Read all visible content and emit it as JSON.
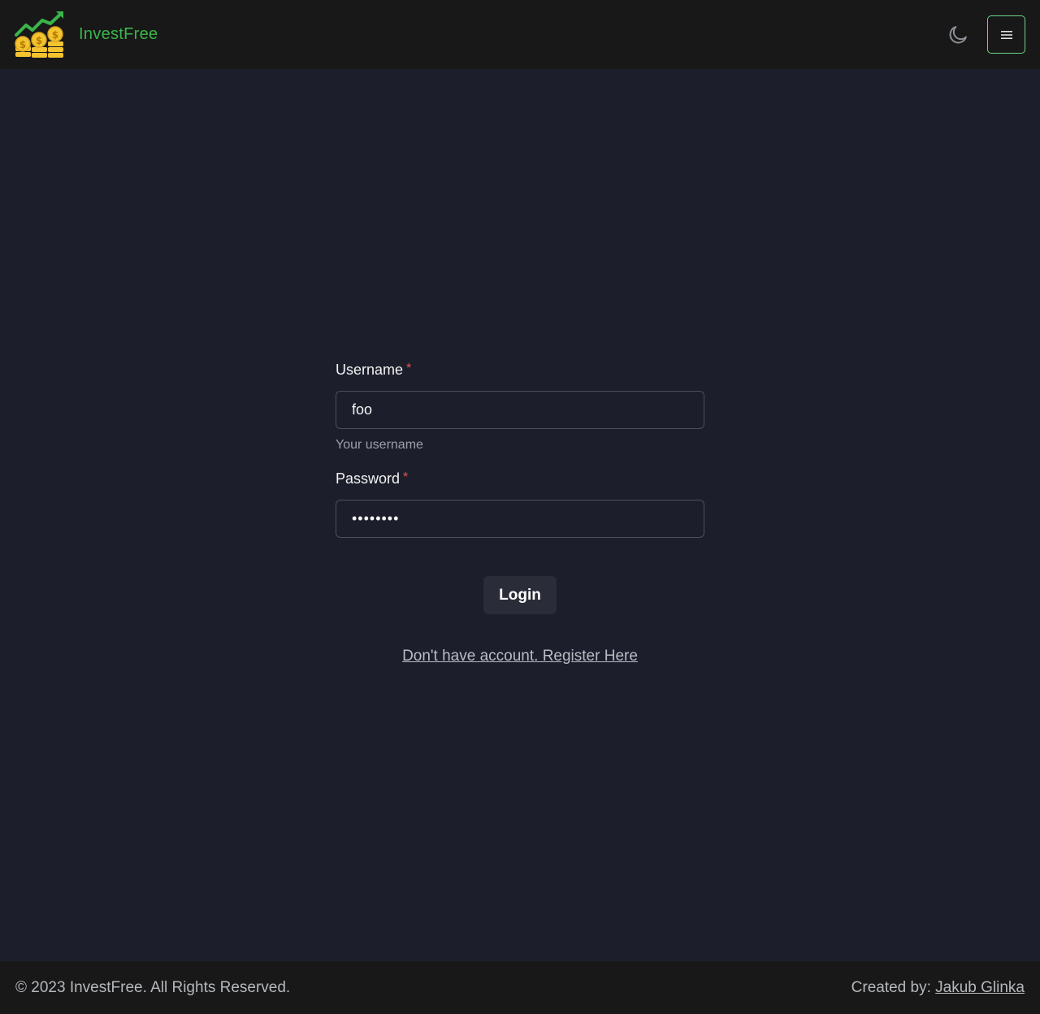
{
  "header": {
    "brand_name": "InvestFree",
    "logo_icon": "rising-chart-coins-logo",
    "theme_toggle_icon": "moon-icon",
    "menu_icon": "hamburger-menu-icon"
  },
  "form": {
    "username_label": "Username",
    "username_required": "*",
    "username_value": "foo",
    "username_help": "Your username",
    "password_label": "Password",
    "password_required": "*",
    "password_value": "password",
    "login_label": "Login",
    "register_link": "Don't have account. Register Here"
  },
  "footer": {
    "copyright": "© 2023 InvestFree. All Rights Reserved.",
    "created_by_label": "Created by:",
    "author": "Jakub Glinka"
  },
  "colors": {
    "page_background": "#1c1f2b",
    "bar_background": "#181818",
    "brand_green": "#3bb54a",
    "menu_border": "#6bd38a",
    "required_red": "#e05555",
    "button_background": "#2a2d38"
  }
}
